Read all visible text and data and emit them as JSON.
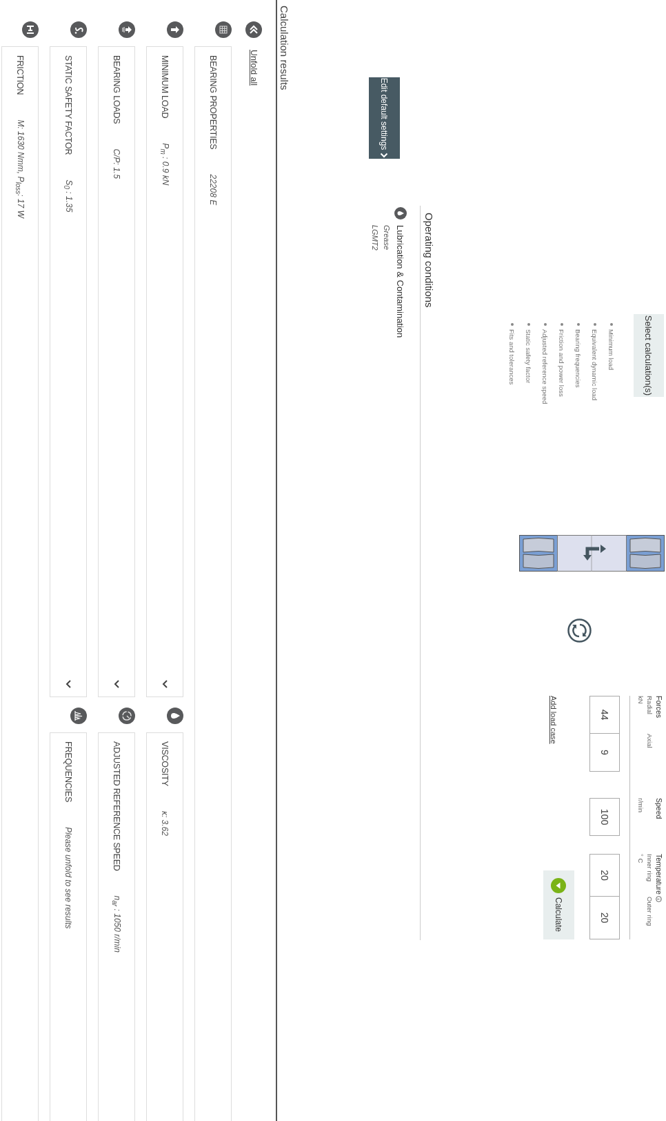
{
  "calculation_select": {
    "button": "Select calculation(s)",
    "items": [
      "Minimum load",
      "Equivalent dynamic load",
      "Bearing frequencies",
      "Friction and power loss",
      "Adjusted reference speed",
      "Static safety factor",
      "Fits and tolerances"
    ]
  },
  "load_case": {
    "forces_label": "Forces",
    "radial_label": "Radial",
    "axial_label": "Axial",
    "forces_unit": "kN",
    "radial": "44",
    "axial": "9",
    "speed_label": "Speed",
    "speed_unit": "r/min",
    "speed": "100",
    "temperature_label": "Temperature",
    "inner_label": "Inner ring",
    "outer_label": "Outer ring",
    "temperature_unit": "° C",
    "inner": "20",
    "outer": "20",
    "add_load_case": "Add load case",
    "calculate": "Calculate"
  },
  "edit_default_settings": "Edit default settings",
  "operating_conditions": {
    "title": "Operating conditions",
    "lubrication_title": "Lubrication & Contamination",
    "lines": [
      "Grease",
      "LGMT2"
    ]
  },
  "results": {
    "title": "Calculation results",
    "unfold_all": "Unfold all",
    "rows": [
      {
        "cards": [
          {
            "title": "BEARING PROPERTIES",
            "value": "22208 E"
          }
        ]
      },
      {
        "cards": [
          {
            "title": "MINIMUM LOAD",
            "value": "P$_{m}$ : 0.9 kN",
            "expanded": false
          },
          {
            "title": "VISCOSITY",
            "value": "κ: 3.62"
          }
        ]
      },
      {
        "cards": [
          {
            "title": "BEARING LOADS",
            "value": "C/P: 1.5",
            "expanded": false
          },
          {
            "title": "ADJUSTED REFERENCE SPEED",
            "value": "n$_{ar}$ : 1050 r/min"
          }
        ]
      },
      {
        "cards": [
          {
            "title": "STATIC SAFETY FACTOR",
            "value": "S$_{0}$ : 1.35",
            "expanded": false
          },
          {
            "title": "FREQUENCIES",
            "value": "Please unfold to see results"
          }
        ]
      },
      {
        "cards": [
          {
            "title": "FRICTION",
            "value": "M: 1630 Nmm, P$_{loss}$: 17 W"
          }
        ]
      }
    ]
  }
}
